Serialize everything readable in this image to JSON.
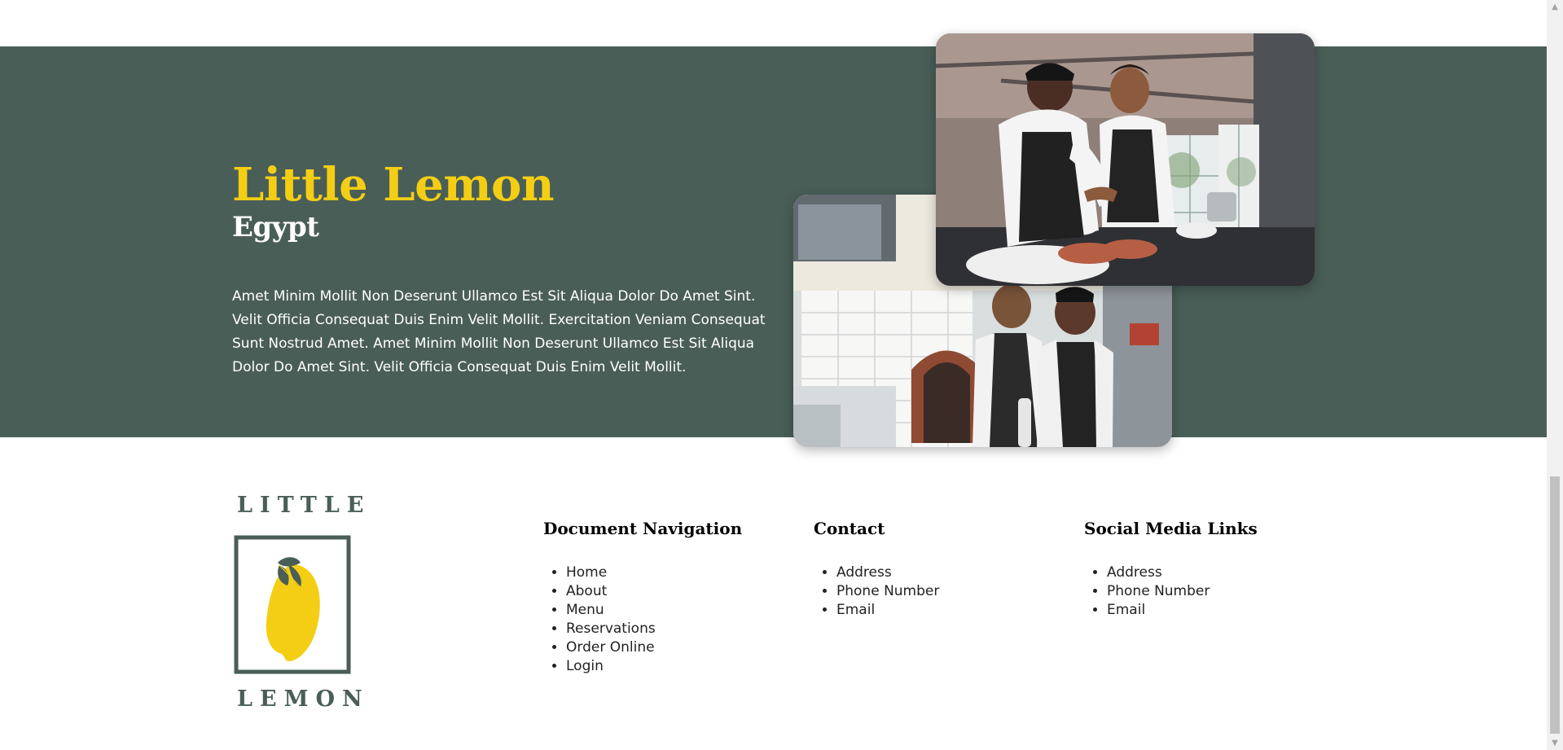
{
  "hero": {
    "title": "Little Lemon",
    "subtitle": "Egypt",
    "body": "Amet Minim Mollit Non Deserunt Ullamco Est Sit Aliqua Dolor Do Amet Sint. Velit Officia Consequat Duis Enim Velit Mollit. Exercitation Veniam Consequat Sunt Nostrud Amet. Amet Minim Mollit Non Deserunt Ullamco Est Sit Aliqua Dolor Do Amet Sint. Velit Officia Consequat Duis Enim Velit Mollit.",
    "images": [
      {
        "icon": "kitchen-photo"
      },
      {
        "icon": "chefs-photo"
      }
    ]
  },
  "footer": {
    "logo": {
      "top_word": "LITTLE",
      "bottom_word": "LEMON",
      "icon": "lemon-logo-icon"
    },
    "navigation": {
      "heading": "Document Navigation",
      "items": [
        "Home",
        "About",
        "Menu",
        "Reservations",
        "Order Online",
        "Login"
      ]
    },
    "contact": {
      "heading": "Contact",
      "items": [
        "Address",
        "Phone Number",
        "Email"
      ]
    },
    "social": {
      "heading": "Social Media Links",
      "items": [
        "Address",
        "Phone Number",
        "Email"
      ]
    }
  },
  "scrollbar": {
    "up_icon": "▲",
    "down_icon": "▼"
  },
  "colors": {
    "primary_green": "#495e57",
    "primary_yellow": "#f4ce14",
    "white": "#ffffff"
  }
}
